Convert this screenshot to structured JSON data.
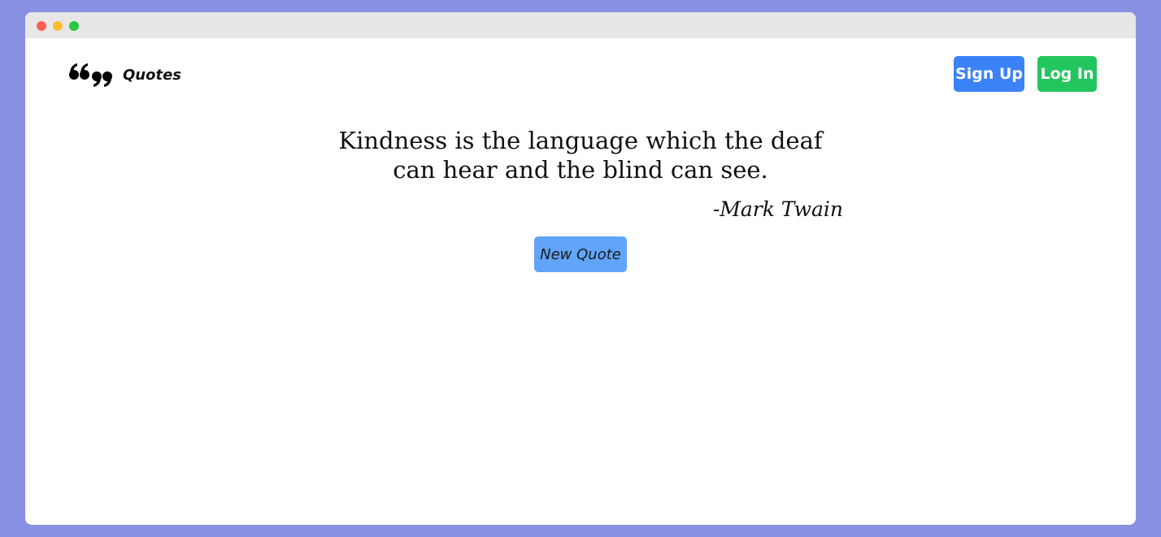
{
  "colors": {
    "background": "#8890e1",
    "titlebar": "#e7e7e8",
    "dot_red": "#fe5f57",
    "dot_yellow": "#febc2e",
    "dot_green": "#28c840",
    "signup_bg": "#3b82f6",
    "login_bg": "#22c55e",
    "new_quote_bg": "#60a5fa"
  },
  "brand": {
    "icon": "quote-marks-icon",
    "label": "Quotes"
  },
  "nav": {
    "signup_label": "Sign Up",
    "login_label": "Log In"
  },
  "quote": {
    "text": "Kindness is the language which the deaf can hear and the blind can see.",
    "author": "-Mark Twain"
  },
  "actions": {
    "new_quote_label": "New Quote"
  }
}
